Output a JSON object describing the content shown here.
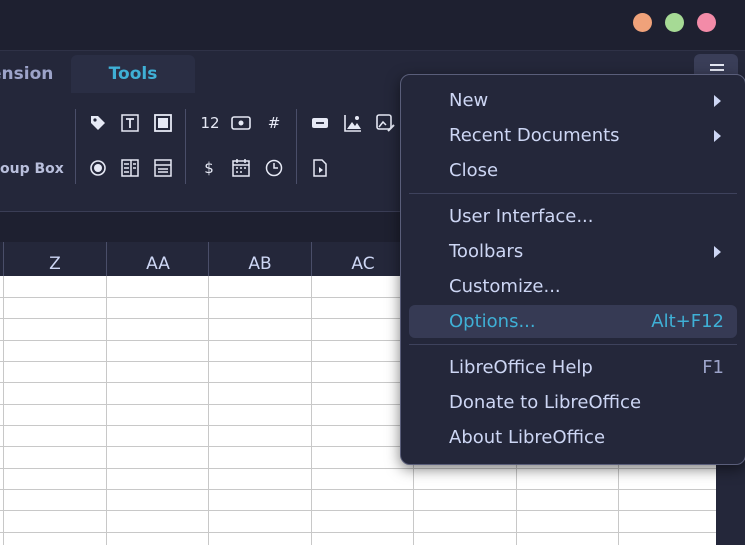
{
  "window": {
    "controls": [
      {
        "name": "minimize",
        "color": "#f0a27a"
      },
      {
        "name": "maximize",
        "color": "#a6da95"
      },
      {
        "name": "close",
        "color": "#f38ba8"
      }
    ]
  },
  "tabs": {
    "extension_label": "ension",
    "tools_label": "Tools"
  },
  "toolbar": {
    "groupbox_label": "oup Box",
    "icons": [
      "tag-icon",
      "text-box-icon",
      "frame-icon",
      "radio-button-icon",
      "list-box-icon",
      "combo-box-icon",
      "numeric-field-icon",
      "image-button-icon",
      "pattern-field-icon",
      "currency-field-icon",
      "date-field-icon",
      "time-field-icon",
      "push-button-icon",
      "image-control-icon",
      "file-selection-icon",
      "navigation-bar-icon"
    ],
    "numeric_label": "12",
    "hash_label": "#",
    "currency_label": "$"
  },
  "columns": [
    "Z",
    "AA",
    "AB",
    "AC"
  ],
  "menu": {
    "button_icon": "hamburger-icon",
    "items": [
      {
        "label": "New",
        "submenu": true
      },
      {
        "label": "Recent Documents",
        "submenu": true
      },
      {
        "label": "Close"
      },
      {
        "label": "User Interface..."
      },
      {
        "label": "Toolbars",
        "submenu": true
      },
      {
        "label": "Customize..."
      },
      {
        "label": "Options...",
        "accelerator": "Alt+F12",
        "selected": true
      },
      {
        "label": "LibreOffice Help",
        "accelerator": "F1"
      },
      {
        "label": "Donate to LibreOffice"
      },
      {
        "label": "About LibreOffice"
      }
    ]
  },
  "colors": {
    "accent": "#3fb0d6",
    "background": "#1e2030",
    "panel": "#24273a"
  }
}
